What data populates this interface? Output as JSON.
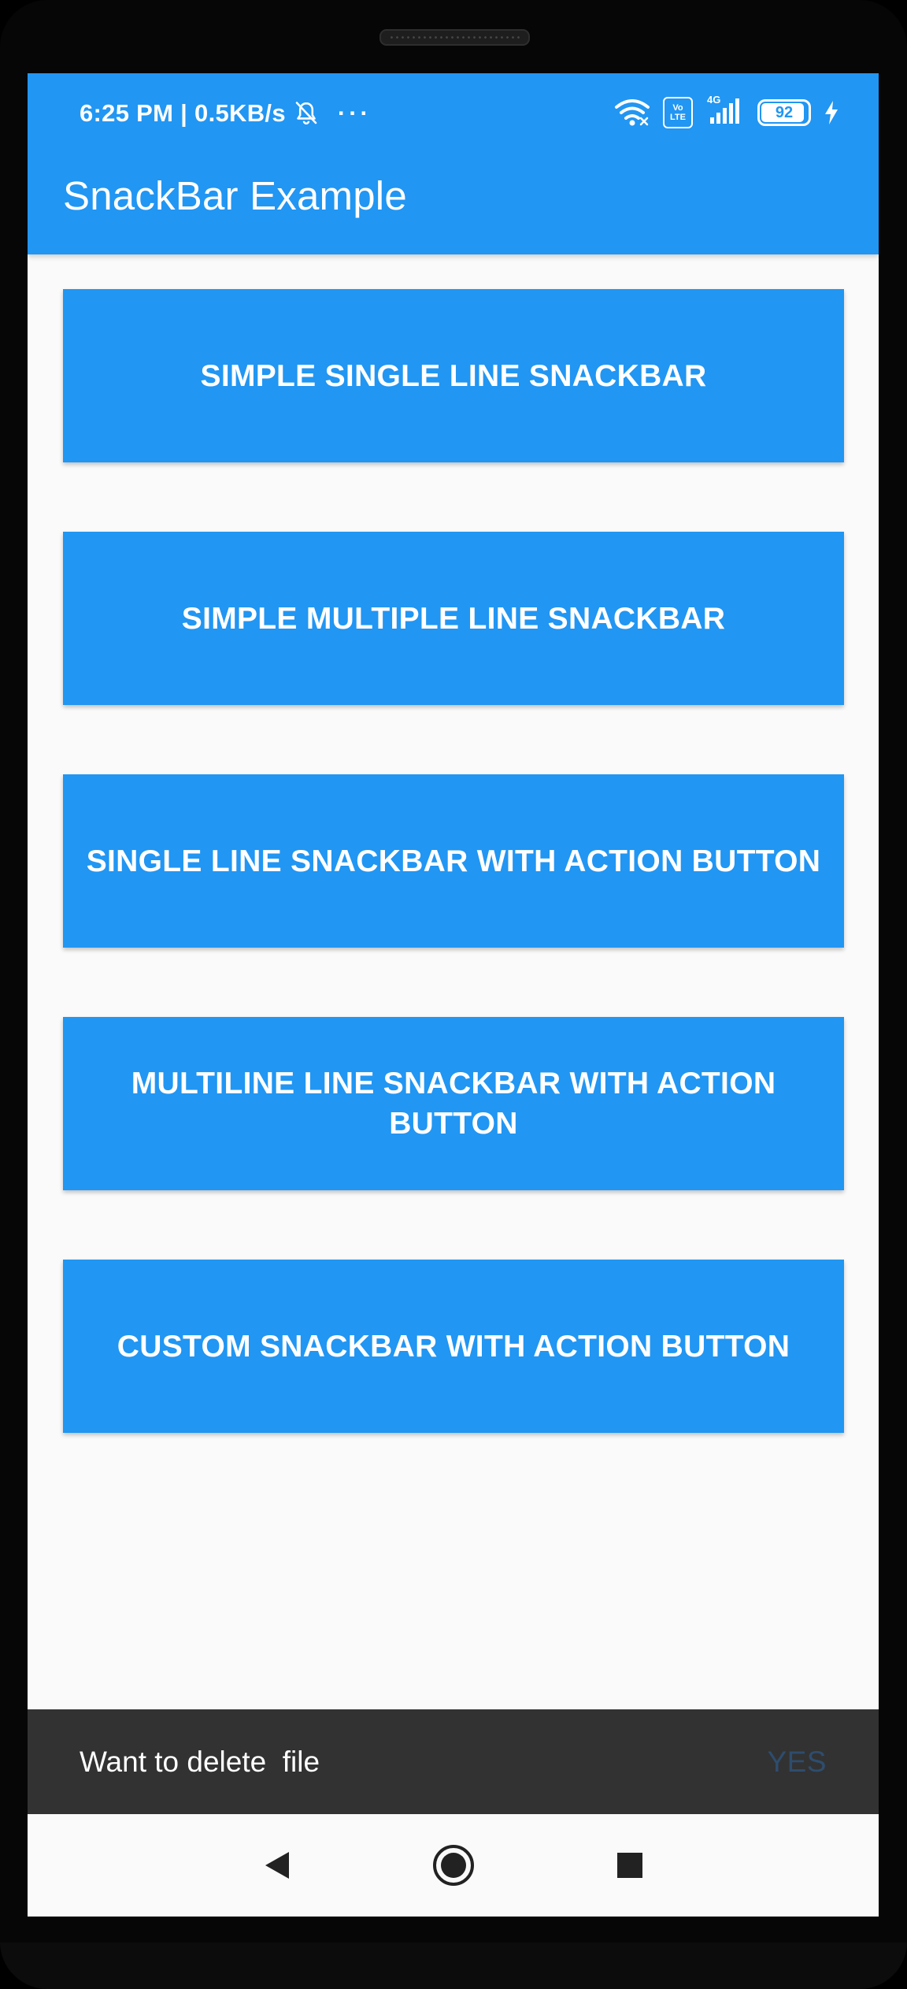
{
  "status_bar": {
    "time_and_speed": "6:25 PM | 0.5KB/s",
    "more_indicator": "···",
    "volte_line1": "Vo",
    "volte_line2": "LTE",
    "network_type": "4G",
    "battery_percent": "92",
    "icons": [
      "bell-off-icon",
      "wifi-icon",
      "volte-icon",
      "signal-icon",
      "battery-icon",
      "charging-bolt-icon"
    ]
  },
  "appbar": {
    "title": "SnackBar Example",
    "color": "#2196f3"
  },
  "buttons": [
    {
      "label": "SIMPLE SINGLE LINE SNACKBAR"
    },
    {
      "label": "SIMPLE MULTIPLE LINE SNACKBAR"
    },
    {
      "label": "SINGLE LINE SNACKBAR WITH ACTION BUTTON"
    },
    {
      "label": "MULTILINE LINE SNACKBAR WITH ACTION BUTTON"
    },
    {
      "label": "CUSTOM SNACKBAR WITH ACTION BUTTON"
    }
  ],
  "snackbar": {
    "message": "Want to delete  file",
    "action": "YES",
    "background": "#323232",
    "action_color": "#2e4d6e"
  },
  "navigation_bar": {
    "icons": [
      "back-triangle-icon",
      "home-circle-icon",
      "recents-square-icon"
    ]
  }
}
